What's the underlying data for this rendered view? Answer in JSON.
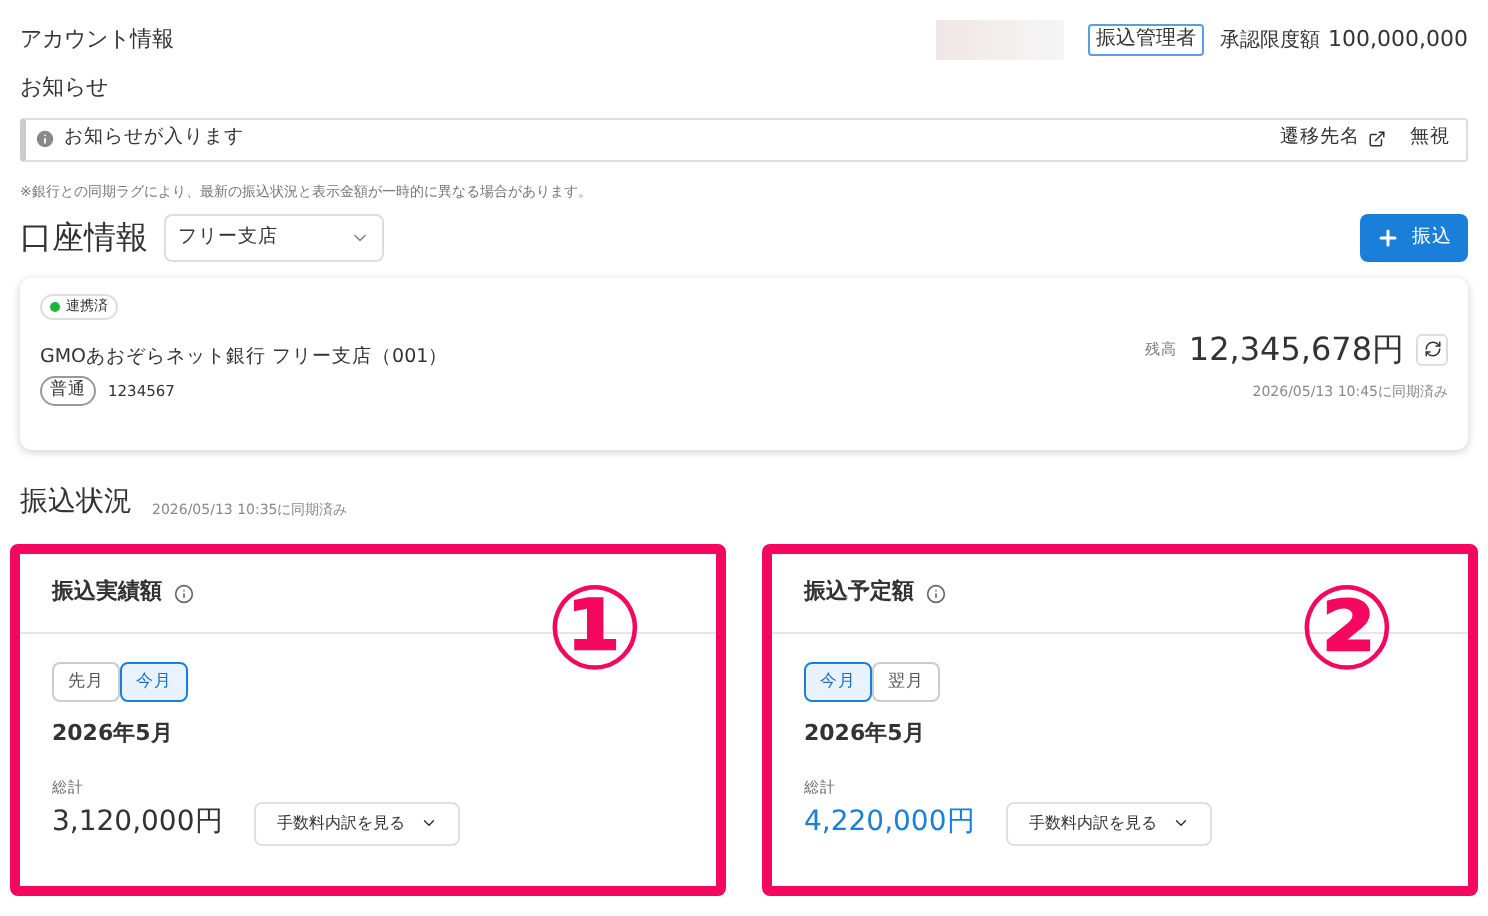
{
  "header": {
    "title": "アカウント情報",
    "role_badge": "振込管理者",
    "limit_label": "承認限度額",
    "limit_value": "100,000,000"
  },
  "notice": {
    "title": "お知らせ",
    "message": "お知らせが入ります",
    "link": "遷移先名",
    "dismiss": "無視"
  },
  "disclaimer": "※銀行との同期ラグにより、最新の振込状況と表示金額が一時的に異なる場合があります。",
  "account_section": {
    "title": "口座情報",
    "branch_select": "フリー支店",
    "transfer_button": "振込"
  },
  "account": {
    "status": "連携済",
    "bank": "GMOあおぞらネット銀行 フリー支店（001）",
    "type": "普通",
    "number": "1234567",
    "balance_label": "残高",
    "balance": "12,345,678円",
    "synced": "2026/05/13 10:45に同期済み"
  },
  "status_section": {
    "title": "振込状況",
    "synced": "2026/05/13 10:35に同期済み"
  },
  "cards": [
    {
      "title": "振込実績額",
      "annotation": "①",
      "tabs": [
        {
          "label": "先月",
          "selected": false
        },
        {
          "label": "今月",
          "selected": true
        }
      ],
      "month": "2026年5月",
      "total_label": "総計",
      "amount": "3,120,000円",
      "color": "#333333",
      "fee_button": "手数料内訳を見る"
    },
    {
      "title": "振込予定額",
      "annotation": "②",
      "tabs": [
        {
          "label": "今月",
          "selected": true
        },
        {
          "label": "翌月",
          "selected": false
        }
      ],
      "month": "2026年5月",
      "total_label": "総計",
      "amount": "4,220,000円",
      "color": "#1a7fd9",
      "fee_button": "手数料内訳を見る"
    }
  ]
}
